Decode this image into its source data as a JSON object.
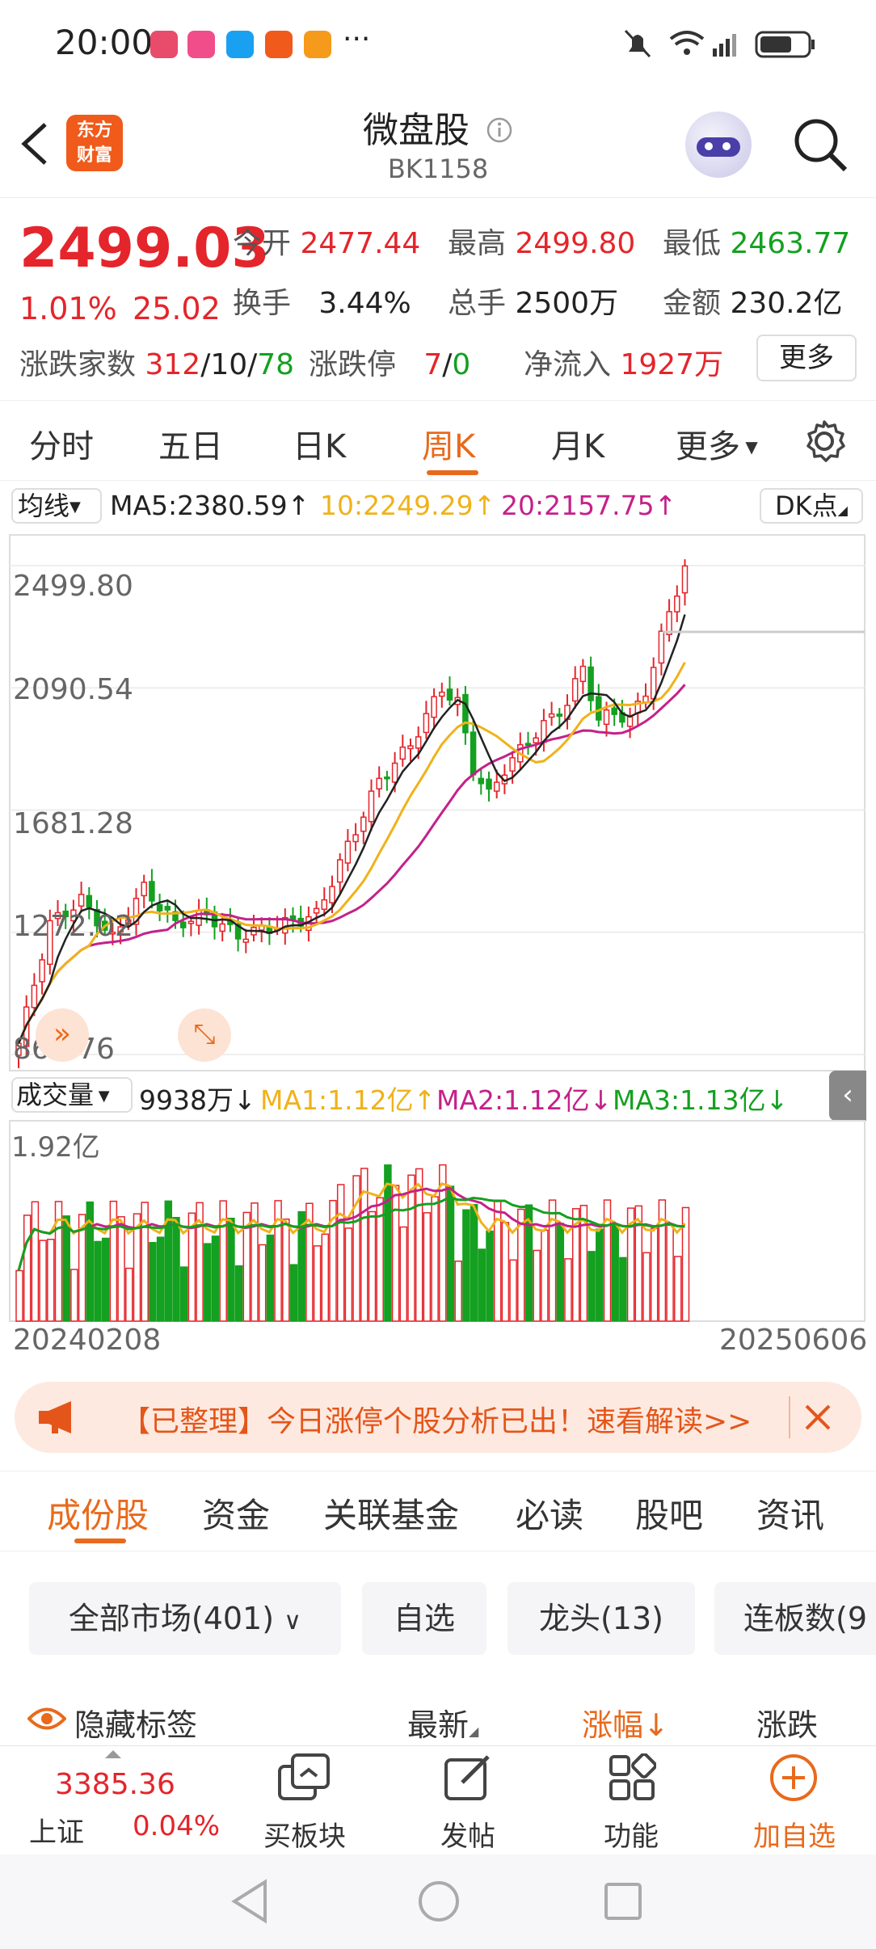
{
  "status_bar": {
    "time": "20:00",
    "more": "···"
  },
  "header": {
    "logo_text_1": "东方",
    "logo_text_2": "财富",
    "title": "微盘股",
    "code": "BK1158"
  },
  "quote": {
    "price": "2499.03",
    "change_pct": "1.01%",
    "change": "25.02",
    "open_label": "今开",
    "open": "2477.44",
    "high_label": "最高",
    "high": "2499.80",
    "low_label": "最低",
    "low": "2463.77",
    "turnover_label": "换手",
    "turnover": "3.44%",
    "volume_label": "总手",
    "volume": "2500万",
    "amount_label": "金额",
    "amount": "230.2亿",
    "breadth_label": "涨跌家数",
    "up_count": "312",
    "flat_count": "10",
    "down_count": "78",
    "sep": "/",
    "limit_label": "涨跌停",
    "limit_up": "7",
    "limit_down": "0",
    "inflow_label": "净流入",
    "inflow": "1927万",
    "more_button": "更多"
  },
  "chart_tabs": [
    "分时",
    "五日",
    "日K",
    "周K",
    "月K",
    "更多"
  ],
  "active_chart_tab": "周K",
  "ma_bar": {
    "selector": "均线",
    "ma5": "MA5:2380.59↑",
    "ma10": "10:2249.29↑",
    "ma20": "20:2157.75↑",
    "dk_button": "DK点"
  },
  "volume_bar": {
    "selector": "成交量",
    "vol": "9938万↓",
    "ma1": "MA1:1.12亿↑",
    "ma2": "MA2:1.12亿↓",
    "ma3": "MA3:1.13亿↓"
  },
  "chart_data": {
    "type": "candlestick",
    "y_ticks": [
      "2499.80",
      "2090.54",
      "1681.28",
      "1272.02",
      "862.76"
    ],
    "volume_tick": "1.92亿",
    "start_date": "20240208",
    "end_date": "20250606",
    "ylim": [
      862.76,
      2499.8
    ],
    "colors": {
      "up": "#e4252b",
      "down": "#14a020",
      "ma5": "#222222",
      "ma10": "#f0b21a",
      "ma20": "#c4218a"
    }
  },
  "banner": {
    "text": "【已整理】今日涨停个股分析已出！速看解读>>"
  },
  "section_tabs": [
    "成份股",
    "资金",
    "关联基金",
    "必读",
    "股吧",
    "资讯"
  ],
  "active_section_tab": "成份股",
  "filters": [
    "全部市场(401)",
    "自选",
    "龙头(13)",
    "连板数(9"
  ],
  "list_header": {
    "hide_tags": "隐藏标签",
    "latest": "最新",
    "change_pct": "涨幅↓",
    "change": "涨跌"
  },
  "bottom_bar": {
    "index_value": "3385.36",
    "index_name": "上证",
    "index_change": "0.04%",
    "buy_sector": "买板块",
    "post": "发帖",
    "functions": "功能",
    "add_watch": "加自选"
  }
}
